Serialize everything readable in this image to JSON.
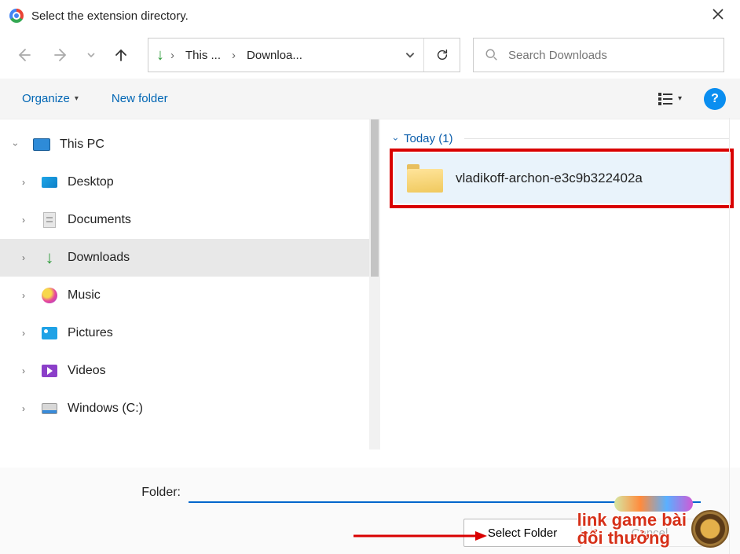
{
  "window": {
    "title": "Select the extension directory."
  },
  "path": {
    "dl_icon": "↓",
    "seg1": "This ...",
    "seg2": "Downloa..."
  },
  "search": {
    "placeholder": "Search Downloads"
  },
  "toolbar": {
    "organize": "Organize",
    "newfolder": "New folder"
  },
  "sidebar": {
    "root": "This PC",
    "items": [
      {
        "label": "Desktop"
      },
      {
        "label": "Documents"
      },
      {
        "label": "Downloads"
      },
      {
        "label": "Music"
      },
      {
        "label": "Pictures"
      },
      {
        "label": "Videos"
      },
      {
        "label": "Windows (C:)"
      }
    ]
  },
  "content": {
    "group": "Today (1)",
    "item": "vladikoff-archon-e3c9b322402a"
  },
  "footer": {
    "folder_label": "Folder:",
    "folder_value": "",
    "select": "Select Folder",
    "cancel": "Cancel"
  },
  "overlay": {
    "line1": "link game bài",
    "line2": "đổi thưởng"
  }
}
